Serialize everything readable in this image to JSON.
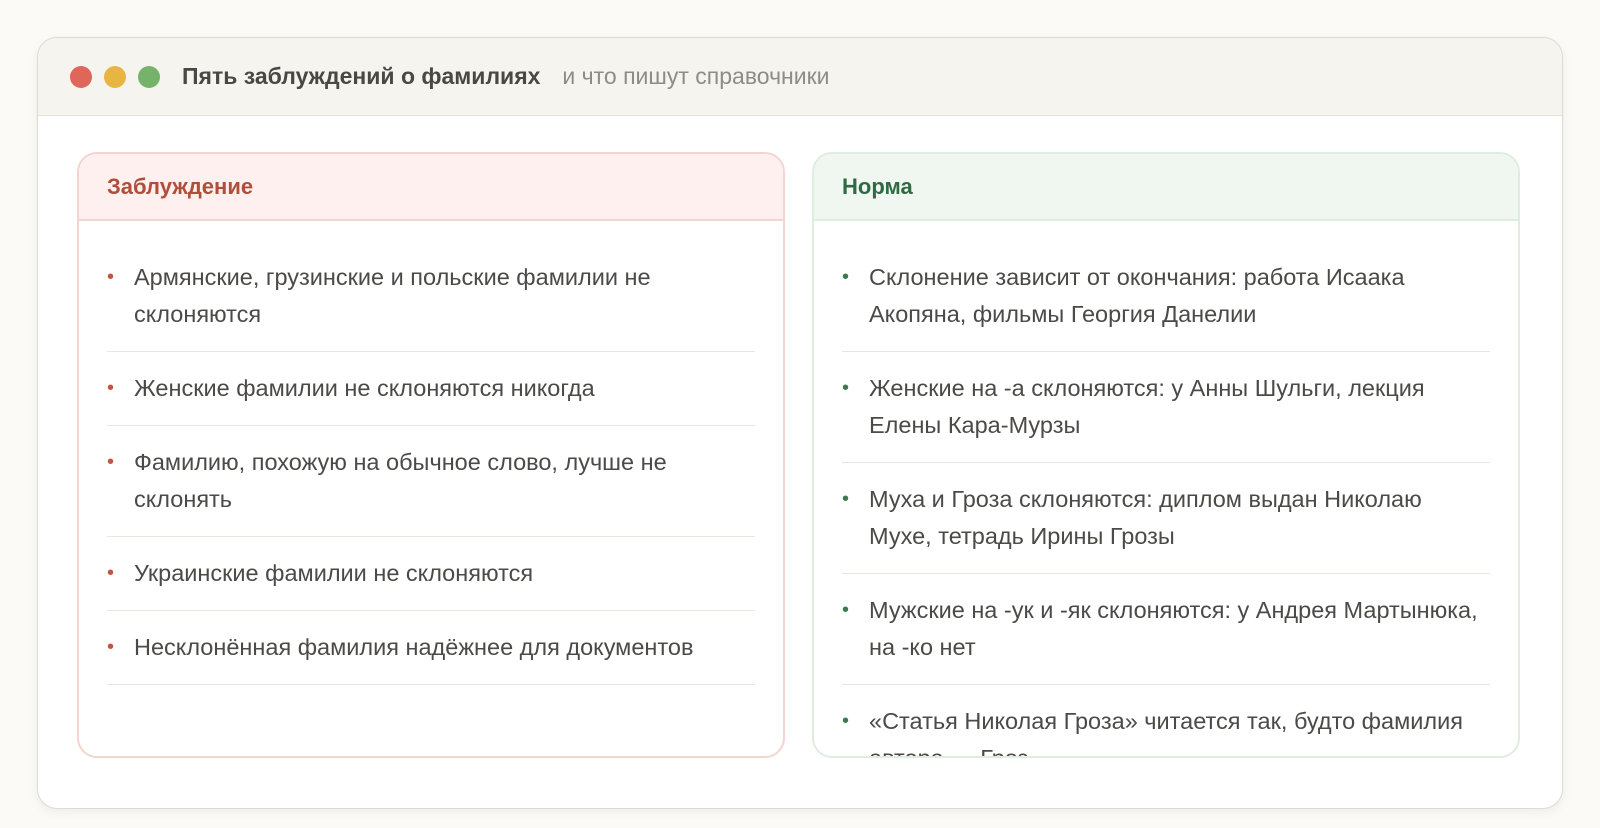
{
  "window": {
    "title": "Пять заблуждений о фамилиях",
    "subtitle": "и что пишут справочники",
    "controls": {
      "close_color": "#e0655a",
      "minimize_color": "#e8b542",
      "zoom_color": "#77b26b"
    }
  },
  "myths": {
    "heading": "Заблуждение",
    "accent": "#b04e39",
    "items": [
      "Армянские, грузинские и польские фамилии не склоняются",
      "Женские фамилии не склоняются никогда",
      "Фамилию, похожую на обычное слово, лучше не склонять",
      "Украинские фамилии не склоняются",
      "Несклонённая фамилия надёжнее для документов"
    ]
  },
  "norms": {
    "heading": "Норма",
    "accent": "#2f6a45",
    "items": [
      "Склонение зависит от окончания: работа Исаака Акопяна, фильмы Георгия Данелии",
      "Женские на ‑а склоняются: у Анны Шульги, лекция Елены Кара‑Мурзы",
      "Муха и Гроза склоняются: диплом выдан Николаю Мухе, тетрадь Ирины Грозы",
      "Мужские на ‑ук и ‑як склоняются: у Андрея Мартынюка, на ‑ко нет",
      "«Статья Николая Гроза» читается так, будто фамилия автора — Гроз"
    ]
  }
}
